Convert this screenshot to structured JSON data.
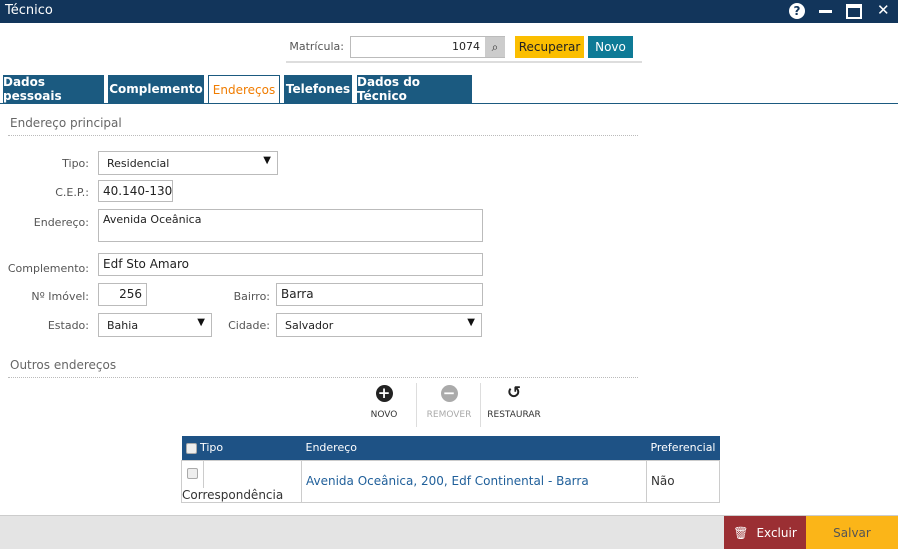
{
  "window": {
    "title": "Técnico",
    "help_icon": "question-circle-icon",
    "minimize_icon": "minimize-icon",
    "maximize_icon": "maximize-icon",
    "close_icon": "close-icon"
  },
  "header": {
    "matricula_label": "Matrícula:",
    "matricula_value": "1074",
    "search_icon": "search-list-icon",
    "recuperar_label": "Recuperar",
    "novo_label": "Novo"
  },
  "tabs": [
    {
      "label": "Dados pessoais"
    },
    {
      "label": "Complemento"
    },
    {
      "label": "Endereços",
      "active": true
    },
    {
      "label": "Telefones"
    },
    {
      "label": "Dados do Técnico"
    }
  ],
  "principal": {
    "section_title": "Endereço principal",
    "tipo_label": "Tipo:",
    "tipo_value": "Residencial",
    "cep_label": "C.E.P.:",
    "cep_value": "40.140-130",
    "endereco_label": "Endereço:",
    "endereco_value": "Avenida Oceânica",
    "complemento_label": "Complemento:",
    "complemento_value": "Edf Sto Amaro",
    "imovel_label": "Nº Imóvel:",
    "imovel_value": "256",
    "bairro_label": "Bairro:",
    "bairro_value": "Barra",
    "estado_label": "Estado:",
    "estado_value": "Bahia",
    "cidade_label": "Cidade:",
    "cidade_value": "Salvador"
  },
  "outros": {
    "section_title": "Outros endereços",
    "toolbar": {
      "novo": "NOVO",
      "remover": "REMOVER",
      "restaurar": "RESTAURAR"
    },
    "columns": [
      "Tipo",
      "Endereço",
      "Preferencial"
    ],
    "rows": [
      {
        "tipo": "Correspondência",
        "endereco": "Avenida Oceânica, 200, Edf Continental - Barra",
        "preferencial": "Não"
      }
    ]
  },
  "footer": {
    "excluir": "Excluir",
    "salvar": "Salvar"
  },
  "colors": {
    "titlebar": "#12355b",
    "tab": "#1b5a80",
    "active_tab_text": "#f07c00",
    "recuperar": "#fbbe00",
    "novo": "#0e7a96",
    "excluir": "#9b2f33",
    "salvar": "#fbb518"
  }
}
